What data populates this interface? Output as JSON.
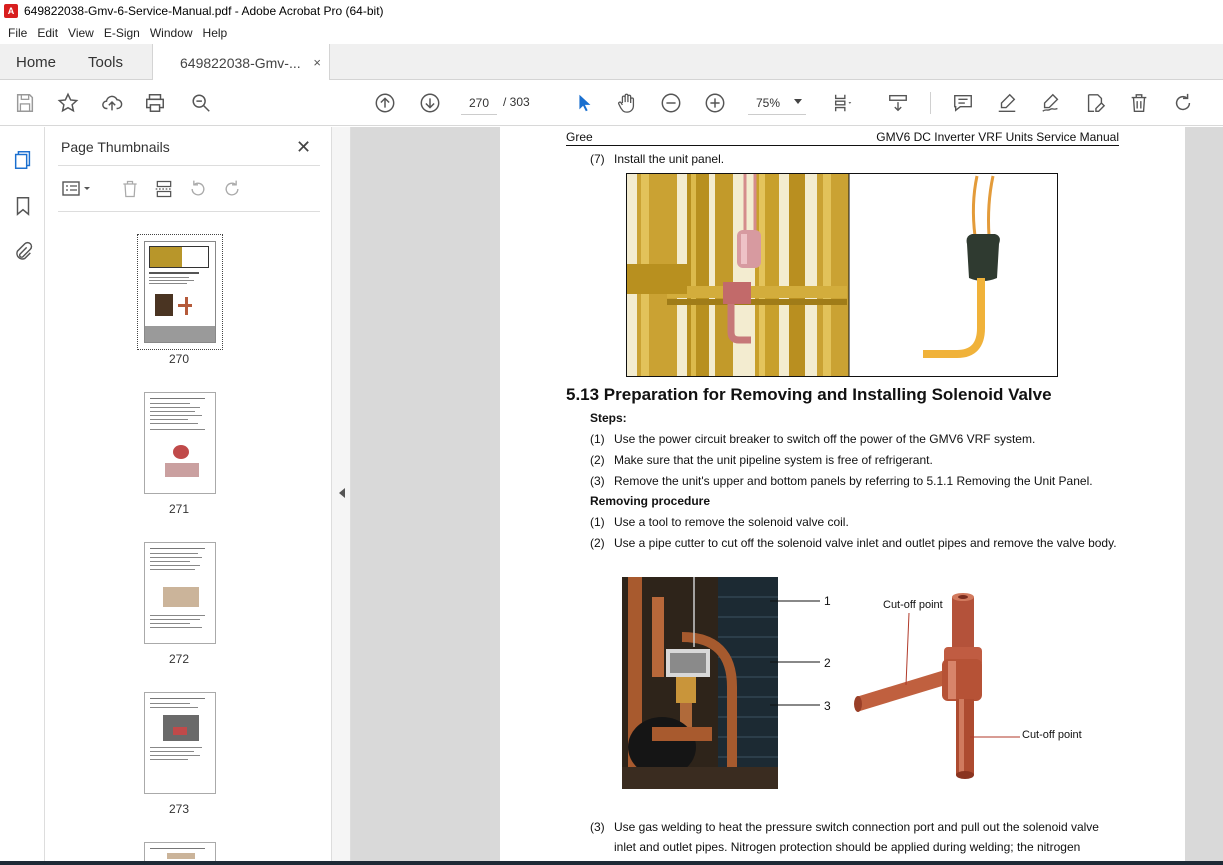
{
  "window": {
    "title": "649822038-Gmv-6-Service-Manual.pdf - Adobe Acrobat Pro (64-bit)"
  },
  "menu": [
    "File",
    "Edit",
    "View",
    "E-Sign",
    "Window",
    "Help"
  ],
  "tabs": {
    "home": "Home",
    "tools": "Tools",
    "doc": "649822038-Gmv-...",
    "doc_close": "×"
  },
  "toolbar": {
    "page_current": "270",
    "page_total": "/ 303",
    "zoom": "75%"
  },
  "thumbnails": {
    "title": "Page Thumbnails",
    "close": "✕",
    "pages": [
      "270",
      "271",
      "272",
      "273"
    ]
  },
  "page": {
    "header_left": "Gree",
    "header_right": "GMV6 DC Inverter VRF Units Service Manual",
    "step7_num": "(7)",
    "step7_text": "Install the unit panel.",
    "heading": "5.13 Preparation for Removing and Installing Solenoid Valve",
    "steps_label": "Steps:",
    "steps": [
      {
        "num": "(1)",
        "text": "Use the power circuit breaker to switch off the power of the GMV6 VRF system."
      },
      {
        "num": "(2)",
        "text": "Make sure that the unit pipeline system is free of refrigerant."
      },
      {
        "num": "(3)",
        "text": "Remove the unit's upper and bottom panels by referring to 5.1.1 Removing the Unit Panel."
      }
    ],
    "removing_label": "Removing procedure",
    "removing": [
      {
        "num": "(1)",
        "text": "Use a tool to remove the solenoid valve coil."
      },
      {
        "num": "(2)",
        "text": "Use a pipe cutter to cut off the solenoid valve inlet and outlet pipes and remove the valve body."
      }
    ],
    "callouts": [
      "1",
      "2",
      "3"
    ],
    "cutoff1": "Cut-off point",
    "cutoff2": "Cut-off point",
    "step3_num": "(3)",
    "step3_line1": "Use gas welding to heat the pressure switch connection port and pull out the solenoid valve",
    "step3_line2": "inlet and outlet pipes. Nitrogen protection should be applied during welding; the nitrogen"
  }
}
